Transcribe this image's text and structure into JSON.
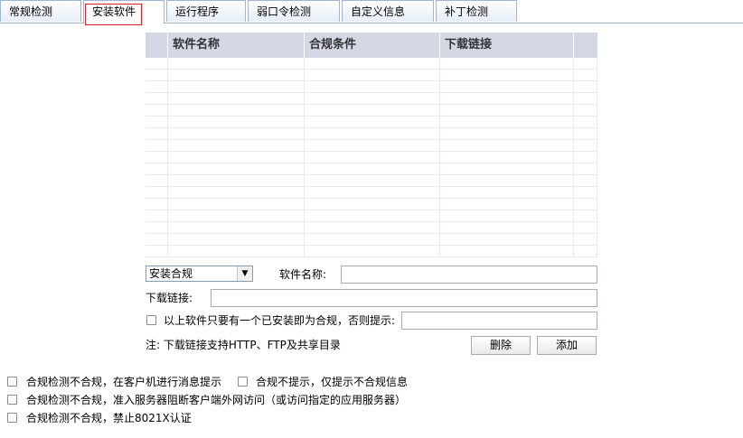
{
  "tabs": [
    {
      "label": "常规检测"
    },
    {
      "label": "安装软件"
    },
    {
      "label": "运行程序"
    },
    {
      "label": "弱口令检测"
    },
    {
      "label": "自定义信息"
    },
    {
      "label": "补丁检测"
    }
  ],
  "table": {
    "columns": [
      "软件名称",
      "合规条件",
      "下载链接"
    ],
    "rows": []
  },
  "form": {
    "compliance_select": "安装合规",
    "software_name_label": "软件名称:",
    "software_name_value": "",
    "download_link_label": "下载链接:",
    "download_link_value": "",
    "any_installed_label": "以上软件只要有一个已安装即为合规，否则提示:",
    "any_installed_checked": false,
    "prompt_value": "",
    "note": "注: 下载链接支持HTTP、FTP及共享目录",
    "delete_button": "删除",
    "add_button": "添加"
  },
  "options": [
    {
      "label": "合规检测不合规，在客户机进行消息提示",
      "checked": false
    },
    {
      "label": "合规不提示，仅提示不合规信息",
      "checked": false
    },
    {
      "label": "合规检测不合规，准入服务器阻断客户端外网访问（或访问指定的应用服务器）",
      "checked": false
    },
    {
      "label": "合规检测不合规，禁止8021X认证",
      "checked": false
    }
  ]
}
